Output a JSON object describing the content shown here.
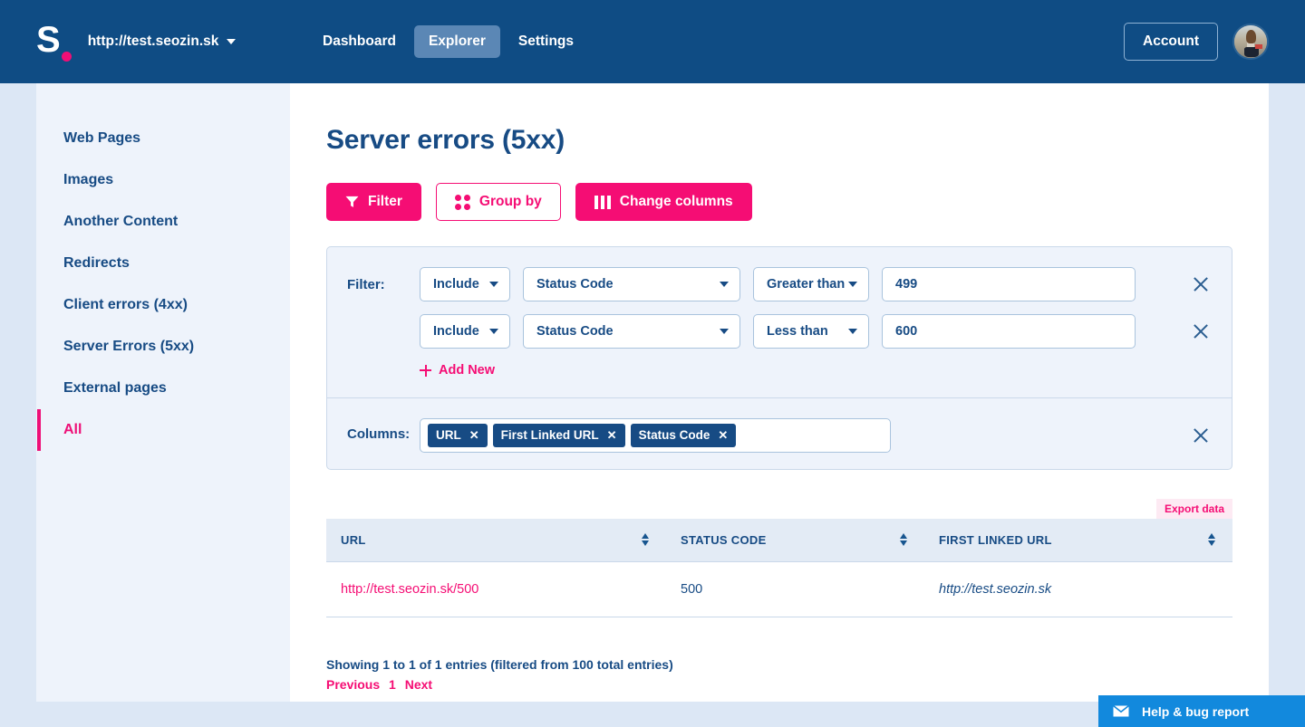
{
  "header": {
    "logo_letter": "S",
    "site_url": "http://test.seozin.sk",
    "nav": [
      {
        "label": "Dashboard",
        "active": false
      },
      {
        "label": "Explorer",
        "active": true
      },
      {
        "label": "Settings",
        "active": false
      }
    ],
    "account_label": "Account"
  },
  "sidebar": {
    "items": [
      {
        "label": "Web Pages",
        "active": false
      },
      {
        "label": "Images",
        "active": false
      },
      {
        "label": "Another Content",
        "active": false
      },
      {
        "label": "Redirects",
        "active": false
      },
      {
        "label": "Client errors (4xx)",
        "active": false
      },
      {
        "label": "Server Errors (5xx)",
        "active": false
      },
      {
        "label": "External pages",
        "active": false
      },
      {
        "label": "All",
        "active": true
      }
    ]
  },
  "main": {
    "title": "Server errors (5xx)",
    "toolbar": {
      "filter_label": "Filter",
      "group_by_label": "Group by",
      "change_columns_label": "Change columns"
    },
    "filter_panel": {
      "filter_label": "Filter:",
      "rows": [
        {
          "include": "Include",
          "field": "Status Code",
          "operator": "Greater than",
          "value": "499"
        },
        {
          "include": "Include",
          "field": "Status Code",
          "operator": "Less than",
          "value": "600"
        }
      ],
      "add_new_label": "Add New",
      "columns_label": "Columns:",
      "column_tags": [
        "URL",
        "First Linked URL",
        "Status Code"
      ],
      "tag_remove_glyph": "✕"
    },
    "table": {
      "export_label": "Export data",
      "headers": [
        "URL",
        "STATUS CODE",
        "FIRST LINKED URL"
      ],
      "rows": [
        {
          "url": "http://test.seozin.sk/500",
          "status_code": "500",
          "first_linked_url": "http://test.seozin.sk"
        }
      ],
      "summary": "Showing 1 to 1 of 1 entries (filtered from 100 total entries)",
      "pager": {
        "previous": "Previous",
        "page": "1",
        "next": "Next"
      }
    }
  },
  "help_widget": {
    "label": "Help & bug report"
  },
  "colors": {
    "brand_blue": "#0f4c84",
    "accent_pink": "#f50d74",
    "panel_bg": "#eef3fb",
    "page_bg": "#dce7f5",
    "help_blue": "#1289dd"
  }
}
